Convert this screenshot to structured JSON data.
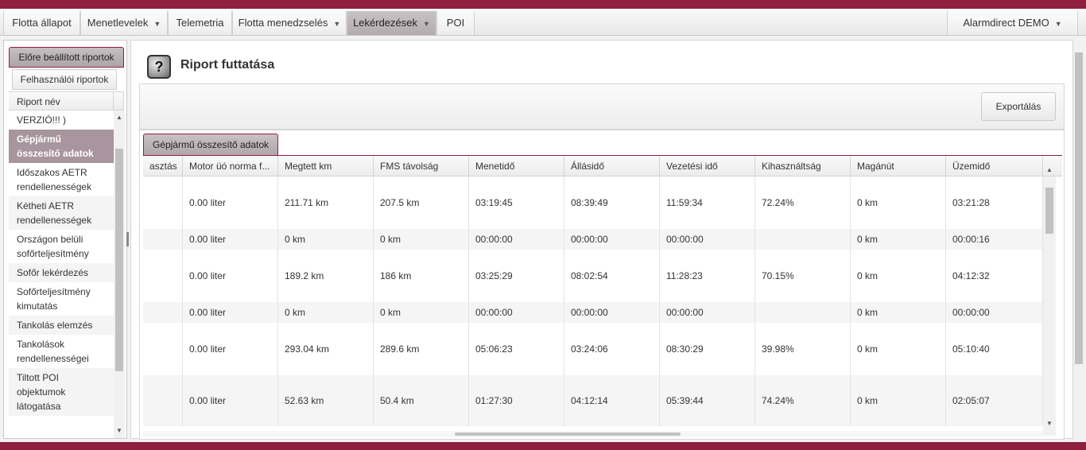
{
  "nav": {
    "items": [
      {
        "label": "Flotta állapot",
        "caret": false
      },
      {
        "label": "Menetlevelek",
        "caret": true
      },
      {
        "label": "Telemetria",
        "caret": false
      },
      {
        "label": "Flotta menedzselés",
        "caret": true
      },
      {
        "label": "Lekérdezések",
        "caret": true
      },
      {
        "label": "POI",
        "caret": false
      }
    ],
    "active": "Lekérdezések",
    "account": "Alarmdirect DEMO",
    "caret_glyph": "▼"
  },
  "sidebar": {
    "tab_preset": "Előre beállított riportok",
    "tab_user": "Felhasználói riportok",
    "column_header": "Riport név",
    "items": [
      {
        "label": "VERZIÓ!!! )"
      },
      {
        "label": "Gépjármű összesítő adatok",
        "selected": true
      },
      {
        "label": "Időszakos AETR rendellenességek"
      },
      {
        "label": "Kétheti AETR rendellenességek"
      },
      {
        "label": "Országon belüli sofőrteljesítmény"
      },
      {
        "label": "Sofőr lekérdezés"
      },
      {
        "label": "Sofőrteljesítmény kimutatás"
      },
      {
        "label": "Tankolás elemzés"
      },
      {
        "label": "Tankolások rendellenességei"
      },
      {
        "label": "Tiltott POI objektumok látogatása"
      }
    ]
  },
  "main": {
    "title": "Riport futtatása",
    "icon": "question-icon",
    "export_label": "Exportálás",
    "data_tab": "Gépjármű összesítő adatok",
    "columns": [
      "asztás",
      "Motor üó norma f...",
      "Megtett km",
      "FMS távolság",
      "Menetidő",
      "Állásidő",
      "Vezetési idő",
      "Kihasználtság",
      "Magánút",
      "Üzemidő"
    ],
    "rows": [
      [
        "",
        "0.00 liter",
        "211.71 km",
        "207.5 km",
        "03:19:45",
        "08:39:49",
        "11:59:34",
        "72.24%",
        "0 km",
        "03:21:28"
      ],
      [
        "",
        "0.00 liter",
        "0 km",
        "0 km",
        "00:00:00",
        "00:00:00",
        "00:00:00",
        "",
        "0 km",
        "00:00:16"
      ],
      [
        "",
        "0.00 liter",
        "189.2 km",
        "186 km",
        "03:25:29",
        "08:02:54",
        "11:28:23",
        "70.15%",
        "0 km",
        "04:12:32"
      ],
      [
        "",
        "0.00 liter",
        "0 km",
        "0 km",
        "00:00:00",
        "00:00:00",
        "00:00:00",
        "",
        "0 km",
        "00:00:00"
      ],
      [
        "",
        "0.00 liter",
        "293.04 km",
        "289.6 km",
        "05:06:23",
        "03:24:06",
        "08:30:29",
        "39.98%",
        "0 km",
        "05:10:40"
      ],
      [
        "",
        "0.00 liter",
        "52.63 km",
        "50.4 km",
        "01:27:30",
        "04:12:14",
        "05:39:44",
        "74.24%",
        "0 km",
        "02:05:07"
      ]
    ]
  },
  "colors": {
    "brand": "#8f1f3f",
    "selected_item": "#a8959d",
    "active_tab": "#b3abae"
  }
}
